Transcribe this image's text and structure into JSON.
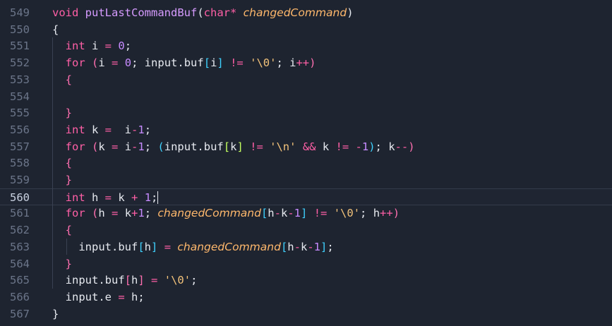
{
  "editor": {
    "lines": [
      {
        "num": "549",
        "tokens": [
          {
            "t": "void ",
            "c": "kw"
          },
          {
            "t": "putLastCommandBuf",
            "c": "fn"
          },
          {
            "t": "(",
            "c": "pn"
          },
          {
            "t": "char",
            "c": "ty"
          },
          {
            "t": "* ",
            "c": "op"
          },
          {
            "t": "changedCommand",
            "c": "pa"
          },
          {
            "t": ")",
            "c": "pn"
          }
        ]
      },
      {
        "num": "550",
        "tokens": [
          {
            "t": "{",
            "c": "pn"
          }
        ]
      },
      {
        "num": "551",
        "tokens": [
          {
            "t": "  ",
            "c": "pn"
          },
          {
            "t": "int",
            "c": "ty"
          },
          {
            "t": " i ",
            "c": "vr"
          },
          {
            "t": "=",
            "c": "op"
          },
          {
            "t": " ",
            "c": "pn"
          },
          {
            "t": "0",
            "c": "nm"
          },
          {
            "t": ";",
            "c": "pn"
          }
        ]
      },
      {
        "num": "552",
        "tokens": [
          {
            "t": "  ",
            "c": "pn"
          },
          {
            "t": "for",
            "c": "kw"
          },
          {
            "t": " ",
            "c": "pn"
          },
          {
            "t": "(",
            "c": "br"
          },
          {
            "t": "i ",
            "c": "vr"
          },
          {
            "t": "=",
            "c": "op"
          },
          {
            "t": " ",
            "c": "pn"
          },
          {
            "t": "0",
            "c": "nm"
          },
          {
            "t": "; input.buf",
            "c": "vr"
          },
          {
            "t": "[",
            "c": "br2"
          },
          {
            "t": "i",
            "c": "vr"
          },
          {
            "t": "]",
            "c": "br2"
          },
          {
            "t": " ",
            "c": "pn"
          },
          {
            "t": "!=",
            "c": "op"
          },
          {
            "t": " ",
            "c": "pn"
          },
          {
            "t": "'\\0'",
            "c": "st"
          },
          {
            "t": "; i",
            "c": "vr"
          },
          {
            "t": "++",
            "c": "op"
          },
          {
            "t": ")",
            "c": "br"
          }
        ]
      },
      {
        "num": "553",
        "tokens": [
          {
            "t": "  ",
            "c": "pn"
          },
          {
            "t": "{",
            "c": "br"
          }
        ]
      },
      {
        "num": "554",
        "tokens": []
      },
      {
        "num": "555",
        "tokens": [
          {
            "t": "  ",
            "c": "pn"
          },
          {
            "t": "}",
            "c": "br"
          }
        ]
      },
      {
        "num": "556",
        "tokens": [
          {
            "t": "  ",
            "c": "pn"
          },
          {
            "t": "int",
            "c": "ty"
          },
          {
            "t": " k ",
            "c": "vr"
          },
          {
            "t": "=",
            "c": "op"
          },
          {
            "t": "  i",
            "c": "vr"
          },
          {
            "t": "-",
            "c": "op"
          },
          {
            "t": "1",
            "c": "nm"
          },
          {
            "t": ";",
            "c": "pn"
          }
        ]
      },
      {
        "num": "557",
        "tokens": [
          {
            "t": "  ",
            "c": "pn"
          },
          {
            "t": "for",
            "c": "kw"
          },
          {
            "t": " ",
            "c": "pn"
          },
          {
            "t": "(",
            "c": "br"
          },
          {
            "t": "k ",
            "c": "vr"
          },
          {
            "t": "=",
            "c": "op"
          },
          {
            "t": " i",
            "c": "vr"
          },
          {
            "t": "-",
            "c": "op"
          },
          {
            "t": "1",
            "c": "nm"
          },
          {
            "t": "; ",
            "c": "pn"
          },
          {
            "t": "(",
            "c": "br2"
          },
          {
            "t": "input.buf",
            "c": "vr"
          },
          {
            "t": "[",
            "c": "br3"
          },
          {
            "t": "k",
            "c": "vr"
          },
          {
            "t": "]",
            "c": "br3"
          },
          {
            "t": " ",
            "c": "pn"
          },
          {
            "t": "!=",
            "c": "op"
          },
          {
            "t": " ",
            "c": "pn"
          },
          {
            "t": "'\\n'",
            "c": "st"
          },
          {
            "t": " ",
            "c": "pn"
          },
          {
            "t": "&&",
            "c": "op"
          },
          {
            "t": " k ",
            "c": "vr"
          },
          {
            "t": "!=",
            "c": "op"
          },
          {
            "t": " ",
            "c": "pn"
          },
          {
            "t": "-",
            "c": "op"
          },
          {
            "t": "1",
            "c": "nm"
          },
          {
            "t": ")",
            "c": "br2"
          },
          {
            "t": "; k",
            "c": "vr"
          },
          {
            "t": "--",
            "c": "op"
          },
          {
            "t": ")",
            "c": "br"
          }
        ]
      },
      {
        "num": "558",
        "tokens": [
          {
            "t": "  ",
            "c": "pn"
          },
          {
            "t": "{",
            "c": "br"
          }
        ]
      },
      {
        "num": "559",
        "tokens": [
          {
            "t": "  ",
            "c": "pn"
          },
          {
            "t": "}",
            "c": "br"
          }
        ]
      },
      {
        "num": "560",
        "current": true,
        "tokens": [
          {
            "t": "  ",
            "c": "pn"
          },
          {
            "t": "int",
            "c": "ty"
          },
          {
            "t": " h ",
            "c": "vr"
          },
          {
            "t": "=",
            "c": "op"
          },
          {
            "t": " k ",
            "c": "vr"
          },
          {
            "t": "+",
            "c": "op"
          },
          {
            "t": " ",
            "c": "pn"
          },
          {
            "t": "1",
            "c": "nm"
          },
          {
            "t": ";",
            "c": "pn"
          }
        ]
      },
      {
        "num": "561",
        "tokens": [
          {
            "t": "  ",
            "c": "pn"
          },
          {
            "t": "for",
            "c": "kw"
          },
          {
            "t": " ",
            "c": "pn"
          },
          {
            "t": "(",
            "c": "br"
          },
          {
            "t": "h ",
            "c": "vr"
          },
          {
            "t": "=",
            "c": "op"
          },
          {
            "t": " k",
            "c": "vr"
          },
          {
            "t": "+",
            "c": "op"
          },
          {
            "t": "1",
            "c": "nm"
          },
          {
            "t": "; ",
            "c": "pn"
          },
          {
            "t": "changedCommand",
            "c": "pa"
          },
          {
            "t": "[",
            "c": "br2"
          },
          {
            "t": "h",
            "c": "vr"
          },
          {
            "t": "-",
            "c": "op"
          },
          {
            "t": "k",
            "c": "vr"
          },
          {
            "t": "-",
            "c": "op"
          },
          {
            "t": "1",
            "c": "nm"
          },
          {
            "t": "]",
            "c": "br2"
          },
          {
            "t": " ",
            "c": "pn"
          },
          {
            "t": "!=",
            "c": "op"
          },
          {
            "t": " ",
            "c": "pn"
          },
          {
            "t": "'\\0'",
            "c": "st"
          },
          {
            "t": "; h",
            "c": "vr"
          },
          {
            "t": "++",
            "c": "op"
          },
          {
            "t": ")",
            "c": "br"
          }
        ]
      },
      {
        "num": "562",
        "tokens": [
          {
            "t": "  ",
            "c": "pn"
          },
          {
            "t": "{",
            "c": "br"
          }
        ]
      },
      {
        "num": "563",
        "tokens": [
          {
            "t": "    ",
            "c": "pn"
          },
          {
            "t": "input.buf",
            "c": "vr"
          },
          {
            "t": "[",
            "c": "br2"
          },
          {
            "t": "h",
            "c": "vr"
          },
          {
            "t": "]",
            "c": "br2"
          },
          {
            "t": " ",
            "c": "pn"
          },
          {
            "t": "=",
            "c": "op"
          },
          {
            "t": " ",
            "c": "pn"
          },
          {
            "t": "changedCommand",
            "c": "pa"
          },
          {
            "t": "[",
            "c": "br2"
          },
          {
            "t": "h",
            "c": "vr"
          },
          {
            "t": "-",
            "c": "op"
          },
          {
            "t": "k",
            "c": "vr"
          },
          {
            "t": "-",
            "c": "op"
          },
          {
            "t": "1",
            "c": "nm"
          },
          {
            "t": "]",
            "c": "br2"
          },
          {
            "t": ";",
            "c": "pn"
          }
        ]
      },
      {
        "num": "564",
        "tokens": [
          {
            "t": "  ",
            "c": "pn"
          },
          {
            "t": "}",
            "c": "br"
          }
        ]
      },
      {
        "num": "565",
        "tokens": [
          {
            "t": "  ",
            "c": "pn"
          },
          {
            "t": "input.buf",
            "c": "vr"
          },
          {
            "t": "[",
            "c": "br"
          },
          {
            "t": "h",
            "c": "vr"
          },
          {
            "t": "]",
            "c": "br"
          },
          {
            "t": " ",
            "c": "pn"
          },
          {
            "t": "=",
            "c": "op"
          },
          {
            "t": " ",
            "c": "pn"
          },
          {
            "t": "'\\0'",
            "c": "st"
          },
          {
            "t": ";",
            "c": "pn"
          }
        ]
      },
      {
        "num": "566",
        "tokens": [
          {
            "t": "  ",
            "c": "pn"
          },
          {
            "t": "input.e ",
            "c": "vr"
          },
          {
            "t": "=",
            "c": "op"
          },
          {
            "t": " h;",
            "c": "vr"
          }
        ]
      },
      {
        "num": "567",
        "tokens": [
          {
            "t": "}",
            "c": "pn"
          }
        ]
      }
    ]
  }
}
